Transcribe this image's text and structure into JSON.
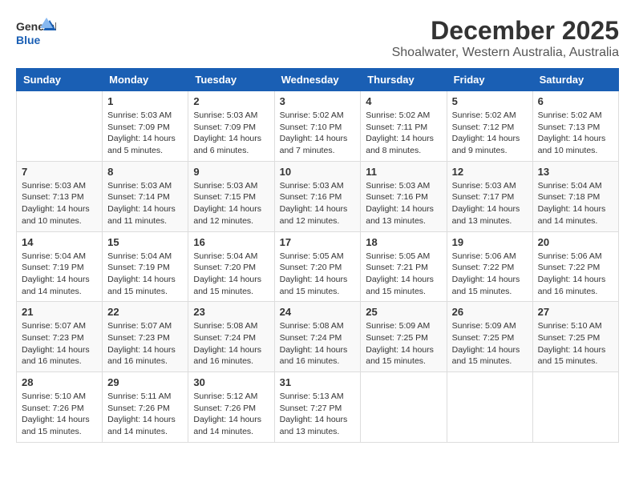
{
  "header": {
    "logo_general": "General",
    "logo_blue": "Blue",
    "title": "December 2025",
    "subtitle": "Shoalwater, Western Australia, Australia"
  },
  "weekdays": [
    "Sunday",
    "Monday",
    "Tuesday",
    "Wednesday",
    "Thursday",
    "Friday",
    "Saturday"
  ],
  "weeks": [
    [
      {
        "day": "",
        "info": ""
      },
      {
        "day": "1",
        "info": "Sunrise: 5:03 AM\nSunset: 7:09 PM\nDaylight: 14 hours\nand 5 minutes."
      },
      {
        "day": "2",
        "info": "Sunrise: 5:03 AM\nSunset: 7:09 PM\nDaylight: 14 hours\nand 6 minutes."
      },
      {
        "day": "3",
        "info": "Sunrise: 5:02 AM\nSunset: 7:10 PM\nDaylight: 14 hours\nand 7 minutes."
      },
      {
        "day": "4",
        "info": "Sunrise: 5:02 AM\nSunset: 7:11 PM\nDaylight: 14 hours\nand 8 minutes."
      },
      {
        "day": "5",
        "info": "Sunrise: 5:02 AM\nSunset: 7:12 PM\nDaylight: 14 hours\nand 9 minutes."
      },
      {
        "day": "6",
        "info": "Sunrise: 5:02 AM\nSunset: 7:13 PM\nDaylight: 14 hours\nand 10 minutes."
      }
    ],
    [
      {
        "day": "7",
        "info": "Sunrise: 5:03 AM\nSunset: 7:13 PM\nDaylight: 14 hours\nand 10 minutes."
      },
      {
        "day": "8",
        "info": "Sunrise: 5:03 AM\nSunset: 7:14 PM\nDaylight: 14 hours\nand 11 minutes."
      },
      {
        "day": "9",
        "info": "Sunrise: 5:03 AM\nSunset: 7:15 PM\nDaylight: 14 hours\nand 12 minutes."
      },
      {
        "day": "10",
        "info": "Sunrise: 5:03 AM\nSunset: 7:16 PM\nDaylight: 14 hours\nand 12 minutes."
      },
      {
        "day": "11",
        "info": "Sunrise: 5:03 AM\nSunset: 7:16 PM\nDaylight: 14 hours\nand 13 minutes."
      },
      {
        "day": "12",
        "info": "Sunrise: 5:03 AM\nSunset: 7:17 PM\nDaylight: 14 hours\nand 13 minutes."
      },
      {
        "day": "13",
        "info": "Sunrise: 5:04 AM\nSunset: 7:18 PM\nDaylight: 14 hours\nand 14 minutes."
      }
    ],
    [
      {
        "day": "14",
        "info": "Sunrise: 5:04 AM\nSunset: 7:19 PM\nDaylight: 14 hours\nand 14 minutes."
      },
      {
        "day": "15",
        "info": "Sunrise: 5:04 AM\nSunset: 7:19 PM\nDaylight: 14 hours\nand 15 minutes."
      },
      {
        "day": "16",
        "info": "Sunrise: 5:04 AM\nSunset: 7:20 PM\nDaylight: 14 hours\nand 15 minutes."
      },
      {
        "day": "17",
        "info": "Sunrise: 5:05 AM\nSunset: 7:20 PM\nDaylight: 14 hours\nand 15 minutes."
      },
      {
        "day": "18",
        "info": "Sunrise: 5:05 AM\nSunset: 7:21 PM\nDaylight: 14 hours\nand 15 minutes."
      },
      {
        "day": "19",
        "info": "Sunrise: 5:06 AM\nSunset: 7:22 PM\nDaylight: 14 hours\nand 15 minutes."
      },
      {
        "day": "20",
        "info": "Sunrise: 5:06 AM\nSunset: 7:22 PM\nDaylight: 14 hours\nand 16 minutes."
      }
    ],
    [
      {
        "day": "21",
        "info": "Sunrise: 5:07 AM\nSunset: 7:23 PM\nDaylight: 14 hours\nand 16 minutes."
      },
      {
        "day": "22",
        "info": "Sunrise: 5:07 AM\nSunset: 7:23 PM\nDaylight: 14 hours\nand 16 minutes."
      },
      {
        "day": "23",
        "info": "Sunrise: 5:08 AM\nSunset: 7:24 PM\nDaylight: 14 hours\nand 16 minutes."
      },
      {
        "day": "24",
        "info": "Sunrise: 5:08 AM\nSunset: 7:24 PM\nDaylight: 14 hours\nand 16 minutes."
      },
      {
        "day": "25",
        "info": "Sunrise: 5:09 AM\nSunset: 7:25 PM\nDaylight: 14 hours\nand 15 minutes."
      },
      {
        "day": "26",
        "info": "Sunrise: 5:09 AM\nSunset: 7:25 PM\nDaylight: 14 hours\nand 15 minutes."
      },
      {
        "day": "27",
        "info": "Sunrise: 5:10 AM\nSunset: 7:25 PM\nDaylight: 14 hours\nand 15 minutes."
      }
    ],
    [
      {
        "day": "28",
        "info": "Sunrise: 5:10 AM\nSunset: 7:26 PM\nDaylight: 14 hours\nand 15 minutes."
      },
      {
        "day": "29",
        "info": "Sunrise: 5:11 AM\nSunset: 7:26 PM\nDaylight: 14 hours\nand 14 minutes."
      },
      {
        "day": "30",
        "info": "Sunrise: 5:12 AM\nSunset: 7:26 PM\nDaylight: 14 hours\nand 14 minutes."
      },
      {
        "day": "31",
        "info": "Sunrise: 5:13 AM\nSunset: 7:27 PM\nDaylight: 14 hours\nand 13 minutes."
      },
      {
        "day": "",
        "info": ""
      },
      {
        "day": "",
        "info": ""
      },
      {
        "day": "",
        "info": ""
      }
    ]
  ]
}
